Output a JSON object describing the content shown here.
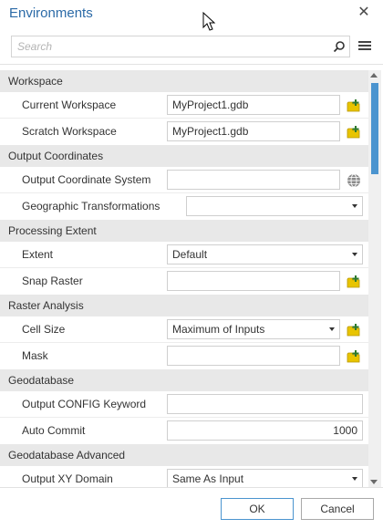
{
  "window": {
    "title": "Environments"
  },
  "search": {
    "placeholder": "Search"
  },
  "sections": {
    "workspace": {
      "title": "Workspace",
      "current_workspace": {
        "label": "Current Workspace",
        "value": "MyProject1.gdb"
      },
      "scratch_workspace": {
        "label": "Scratch Workspace",
        "value": "MyProject1.gdb"
      }
    },
    "output_coordinates": {
      "title": "Output Coordinates",
      "output_coordinate_system": {
        "label": "Output Coordinate System",
        "value": ""
      },
      "geographic_transformations": {
        "label": "Geographic Transformations",
        "value": ""
      }
    },
    "processing_extent": {
      "title": "Processing Extent",
      "extent": {
        "label": "Extent",
        "value": "Default"
      },
      "snap_raster": {
        "label": "Snap Raster",
        "value": ""
      }
    },
    "raster_analysis": {
      "title": "Raster Analysis",
      "cell_size": {
        "label": "Cell Size",
        "value": "Maximum of Inputs"
      },
      "mask": {
        "label": "Mask",
        "value": ""
      }
    },
    "geodatabase": {
      "title": "Geodatabase",
      "output_config_keyword": {
        "label": "Output CONFIG Keyword",
        "value": ""
      },
      "auto_commit": {
        "label": "Auto Commit",
        "value": "1000"
      }
    },
    "geodatabase_advanced": {
      "title": "Geodatabase Advanced",
      "output_xy_domain": {
        "label": "Output XY Domain",
        "value": "Same As Input"
      }
    }
  },
  "buttons": {
    "ok": "OK",
    "cancel": "Cancel"
  },
  "icons": {
    "close": "close-icon",
    "search": "search-icon",
    "menu": "menu-icon",
    "folder_browse": "folder-browse-icon",
    "globe": "globe-icon"
  },
  "colors": {
    "title": "#2b6aa7",
    "section_bg": "#e8e8e8",
    "accent": "#4b94cf",
    "folder": "#e8c400"
  }
}
